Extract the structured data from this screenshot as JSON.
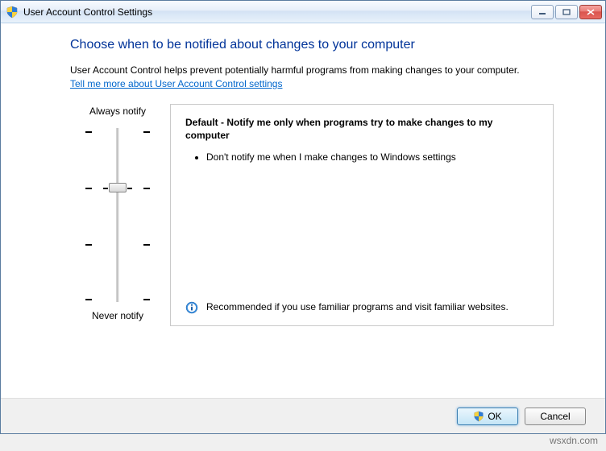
{
  "window": {
    "title": "User Account Control Settings"
  },
  "heading": "Choose when to be notified about changes to your computer",
  "intro": "User Account Control helps prevent potentially harmful programs from making changes to your computer.",
  "link_text": "Tell me more about User Account Control settings",
  "slider": {
    "top_label": "Always notify",
    "bottom_label": "Never notify",
    "position_index": 1,
    "steps": 4
  },
  "description": {
    "title": "Default - Notify me only when programs try to make changes to my computer",
    "bullets": [
      "Don't notify me when I make changes to Windows settings"
    ],
    "recommendation": "Recommended if you use familiar programs and visit familiar websites."
  },
  "buttons": {
    "ok": "OK",
    "cancel": "Cancel"
  },
  "watermark": "wsxdn.com"
}
